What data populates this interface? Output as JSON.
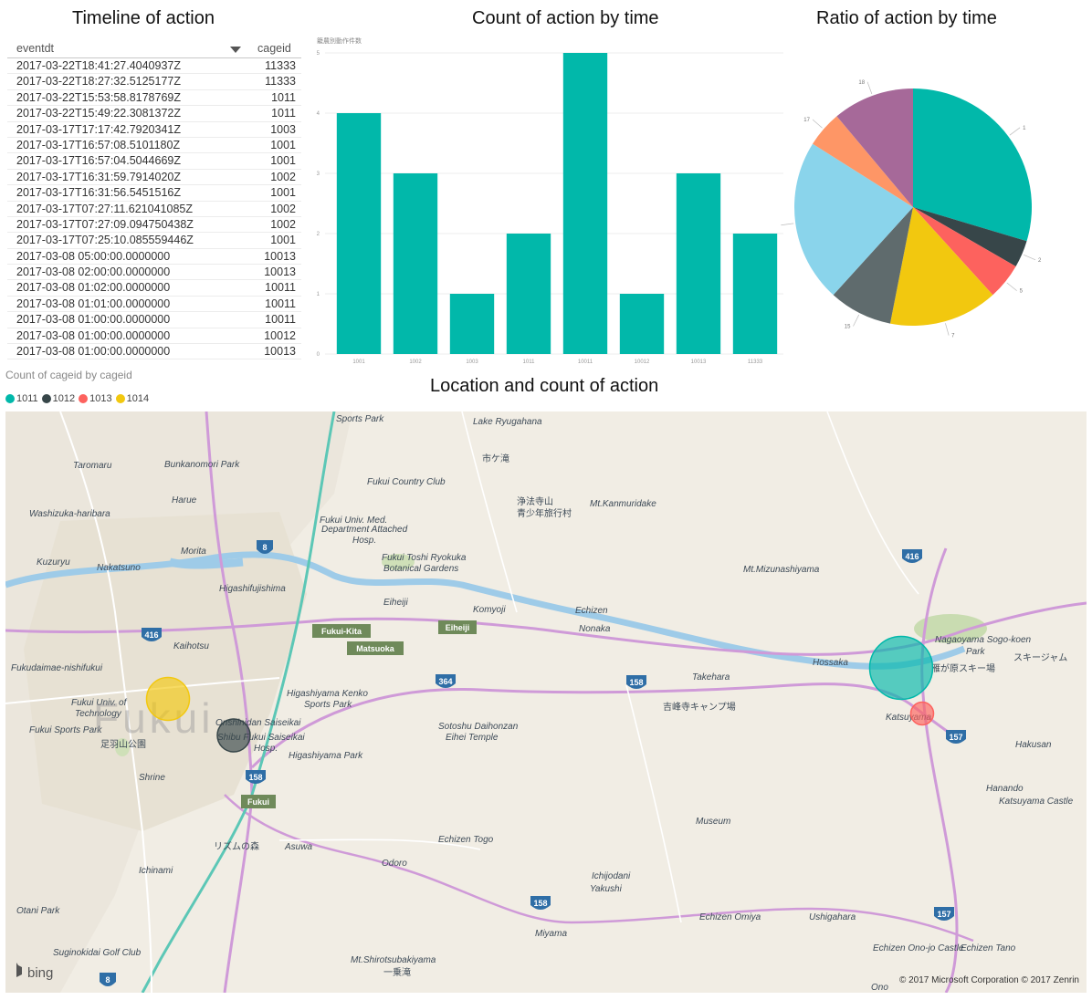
{
  "titles": {
    "timeline": "Timeline of action",
    "count": "Count of action by time",
    "ratio": "Ratio of action by time",
    "location": "Location and count of action"
  },
  "table": {
    "headers": [
      "eventdt",
      "cageid"
    ],
    "rows": [
      [
        "2017-03-22T18:41:27.4040937Z",
        "11333"
      ],
      [
        "2017-03-22T18:27:32.5125177Z",
        "11333"
      ],
      [
        "2017-03-22T15:53:58.8178769Z",
        "1011"
      ],
      [
        "2017-03-22T15:49:22.3081372Z",
        "1011"
      ],
      [
        "2017-03-17T17:17:42.7920341Z",
        "1003"
      ],
      [
        "2017-03-17T16:57:08.5101180Z",
        "1001"
      ],
      [
        "2017-03-17T16:57:04.5044669Z",
        "1001"
      ],
      [
        "2017-03-17T16:31:59.7914020Z",
        "1002"
      ],
      [
        "2017-03-17T16:31:56.5451516Z",
        "1001"
      ],
      [
        "2017-03-17T07:27:11.621041085Z",
        "1002"
      ],
      [
        "2017-03-17T07:27:09.094750438Z",
        "1002"
      ],
      [
        "2017-03-17T07:25:10.085559446Z",
        "1001"
      ],
      [
        "2017-03-08 05:00:00.0000000",
        "10013"
      ],
      [
        "2017-03-08 02:00:00.0000000",
        "10013"
      ],
      [
        "2017-03-08 01:02:00.0000000",
        "10011"
      ],
      [
        "2017-03-08 01:01:00.0000000",
        "10011"
      ],
      [
        "2017-03-08 01:00:00.0000000",
        "10011"
      ],
      [
        "2017-03-08 01:00:00.0000000",
        "10012"
      ],
      [
        "2017-03-08 01:00:00.0000000",
        "10013"
      ]
    ]
  },
  "bar_subtitle": "籠農別動作件数",
  "chart_data": [
    {
      "type": "bar",
      "title": "Count of action by time",
      "categories": [
        "1001",
        "1002",
        "1003",
        "1011",
        "10011",
        "10012",
        "10013",
        "11333"
      ],
      "values": [
        4,
        3,
        1,
        2,
        5,
        1,
        3,
        2
      ],
      "ylim": [
        0,
        5
      ],
      "yticks": [
        "0",
        "1",
        "2",
        "3",
        "4",
        "5"
      ],
      "color": "#01b8aa",
      "grid": true
    },
    {
      "type": "pie",
      "title": "Ratio of action by time",
      "slices": [
        {
          "label": "1",
          "value": 24,
          "color": "#01b8aa"
        },
        {
          "label": "2",
          "value": 3,
          "color": "#374649"
        },
        {
          "label": "5",
          "value": 4,
          "color": "#fd625e"
        },
        {
          "label": "7",
          "value": 12,
          "color": "#f2c80f"
        },
        {
          "label": "15",
          "value": 7,
          "color": "#5f6b6d"
        },
        {
          "label": "",
          "value": 18,
          "color": "#8ad4eb"
        },
        {
          "label": "17",
          "value": 4,
          "color": "#fe9666"
        },
        {
          "label": "18",
          "value": 9,
          "color": "#a66999"
        }
      ]
    }
  ],
  "map_legend": {
    "title": "Count of cageid by cageid",
    "items": [
      {
        "label": "1011",
        "color": "#01b8aa"
      },
      {
        "label": "1012",
        "color": "#374649"
      },
      {
        "label": "1013",
        "color": "#fd625e"
      },
      {
        "label": "1014",
        "color": "#f2c80f"
      }
    ]
  },
  "map": {
    "place_labels": [
      "Sports Park",
      "Lake Ryugahana",
      "市ケ滝",
      "Taromaru",
      "Bunkanomori Park",
      "Fukui Country Club",
      "Harue",
      "浄法寺山",
      "青少年旅行村",
      "Mt.Kanmuridake",
      "Washizuka-haribara",
      "Fukui Univ. Med.",
      "Department Attached",
      "Hosp.",
      "Morita",
      "Kuzuryu",
      "Fukui Toshi Ryokuka",
      "Botanical Gardens",
      "Mt.Mizunashiyama",
      "Nakatsuno",
      "Eiheiji",
      "Komyoji",
      "Higashifujishima",
      "Echizen",
      "Nonaka",
      "Nagaoyama Sogo-koen",
      "Park",
      "Kaihotsu",
      "Hossaka",
      "スキージャム",
      "Fukudaimae-nishifukui",
      "Takehara",
      "雁が原スキー場",
      "Higashiyama Kenko",
      "Sports Park",
      "吉峰寺キャンプ場",
      "Katsuyama",
      "Fukui Univ. of",
      "Technology",
      "Onshinidan Saiseikai",
      "Shibu Fukui Saiseikai",
      "Hosp.",
      "Sotoshu Daihonzan",
      "Eihei Temple",
      "Fukui Sports Park",
      "足羽山公園",
      "Higashiyama Park",
      "Hakusan",
      "Shrine",
      "Hanando",
      "Katsuyama Castle",
      "Museum",
      "リズムの森",
      "Asuwa",
      "Echizen Togo",
      "Ichinami",
      "Odoro",
      "Ichijodani",
      "Yakushi",
      "Echizen Omiya",
      "Ushigahara",
      "Otani Park",
      "Miyama",
      "Echizen Ono-jo Castle",
      "Echizen Tano",
      "Suginokidai Golf Club",
      "Mt.Shirotsubakiyama",
      "一乗滝",
      "Ono",
      "Fukui"
    ],
    "rail_labels": [
      "Fukui-Kita",
      "Matsuoka",
      "Eiheiji",
      "Fukui"
    ],
    "route_numbers": [
      "8",
      "416",
      "364",
      "158",
      "157",
      "416",
      "158",
      "157",
      "158",
      "8"
    ],
    "copyright": "© 2017 Microsoft Corporation   © 2017 Zenrin",
    "logo": "bing",
    "bubbles": [
      {
        "cageid": "1014",
        "color": "#f2c80f",
        "size": 3
      },
      {
        "cageid": "1012",
        "color": "#374649",
        "size": 2
      },
      {
        "cageid": "1011",
        "color": "#01b8aa",
        "size": 5
      },
      {
        "cageid": "1013",
        "color": "#fd625e",
        "size": 1
      }
    ]
  }
}
